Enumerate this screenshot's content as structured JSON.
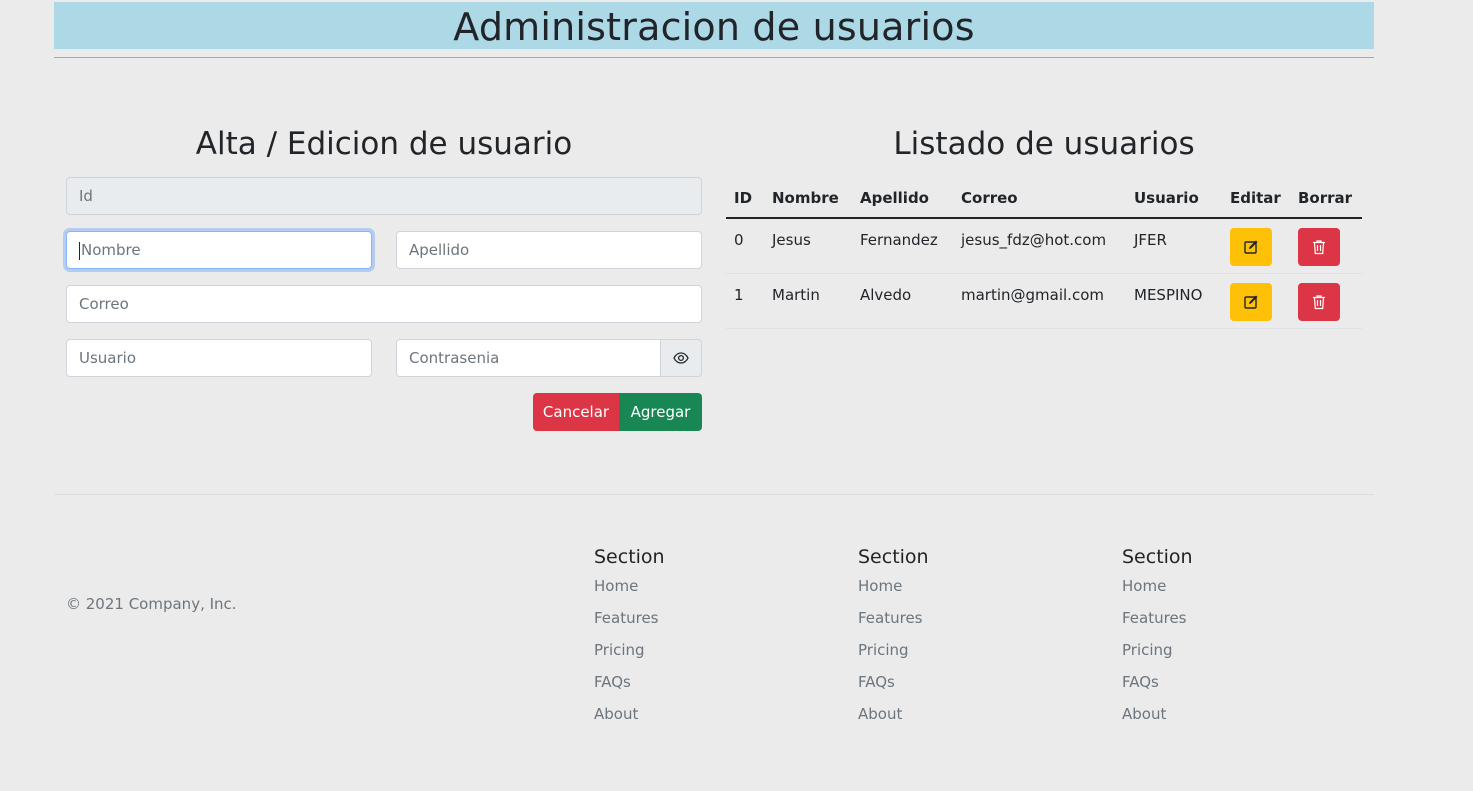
{
  "header": {
    "title": "Administracion de usuarios"
  },
  "form": {
    "title": "Alta / Edicion de usuario",
    "id_placeholder": "Id",
    "nombre_placeholder": "Nombre",
    "apellido_placeholder": "Apellido",
    "correo_placeholder": "Correo",
    "usuario_placeholder": "Usuario",
    "contrasenia_placeholder": "Contrasenia",
    "toggle_icon": "eye-icon",
    "cancel_label": "Cancelar",
    "add_label": "Agregar"
  },
  "list": {
    "title": "Listado de usuarios",
    "columns": [
      "ID",
      "Nombre",
      "Apellido",
      "Correo",
      "Usuario",
      "Editar",
      "Borrar"
    ],
    "rows": [
      {
        "id": "0",
        "nombre": "Jesus",
        "apellido": "Fernandez",
        "correo": "jesus_fdz@hot.com",
        "usuario": "JFER"
      },
      {
        "id": "1",
        "nombre": "Martin",
        "apellido": "Alvedo",
        "correo": "martin@gmail.com",
        "usuario": "MESPINO"
      }
    ],
    "edit_icon": "edit-icon",
    "delete_icon": "trash-icon"
  },
  "footer": {
    "copyright": "© 2021 Company, Inc.",
    "sections": [
      {
        "title": "Section",
        "links": [
          "Home",
          "Features",
          "Pricing",
          "FAQs",
          "About"
        ]
      },
      {
        "title": "Section",
        "links": [
          "Home",
          "Features",
          "Pricing",
          "FAQs",
          "About"
        ]
      },
      {
        "title": "Section",
        "links": [
          "Home",
          "Features",
          "Pricing",
          "FAQs",
          "About"
        ]
      }
    ]
  },
  "colors": {
    "header_bg": "#add8e6",
    "page_bg": "#ebebeb",
    "danger": "#dc3545",
    "success": "#198754",
    "warning": "#ffc107"
  }
}
